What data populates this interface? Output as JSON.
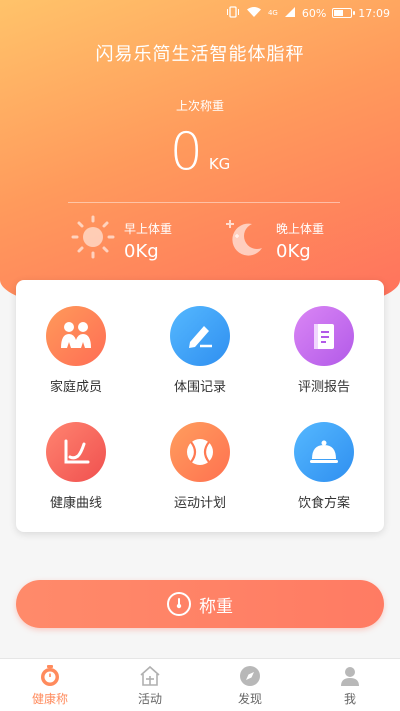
{
  "status": {
    "signal": "4G",
    "battery": "60%",
    "time": "17:09",
    "battery_level": 0.6
  },
  "header": {
    "title": "闪易乐简生活智能体脂秤",
    "last_label": "上次称重",
    "last_value": "0",
    "last_unit": "KG",
    "morning": {
      "label": "早上体重",
      "value": "0Kg"
    },
    "evening": {
      "label": "晚上体重",
      "value": "0Kg"
    }
  },
  "menu": {
    "items": [
      {
        "label": "家庭成员",
        "icon": "family-icon",
        "color": "#ff7d56"
      },
      {
        "label": "体围记录",
        "icon": "pen-icon",
        "color": "#3ea6f5"
      },
      {
        "label": "评测报告",
        "icon": "report-book-icon",
        "color": "#c86cf0"
      },
      {
        "label": "健康曲线",
        "icon": "curve-icon",
        "color": "#ff6b62"
      },
      {
        "label": "运动计划",
        "icon": "tennis-ball-icon",
        "color": "#ff8a58"
      },
      {
        "label": "饮食方案",
        "icon": "dish-cover-icon",
        "color": "#3ea6f5"
      }
    ]
  },
  "weigh_button": {
    "label": "称重",
    "icon": "scale-gauge-icon"
  },
  "tabs": [
    {
      "label": "健康称",
      "icon": "timer-icon",
      "active": true
    },
    {
      "label": "活动",
      "icon": "house-icon",
      "active": false
    },
    {
      "label": "发现",
      "icon": "compass-icon",
      "active": false
    },
    {
      "label": "我",
      "icon": "person-icon",
      "active": false
    }
  ]
}
